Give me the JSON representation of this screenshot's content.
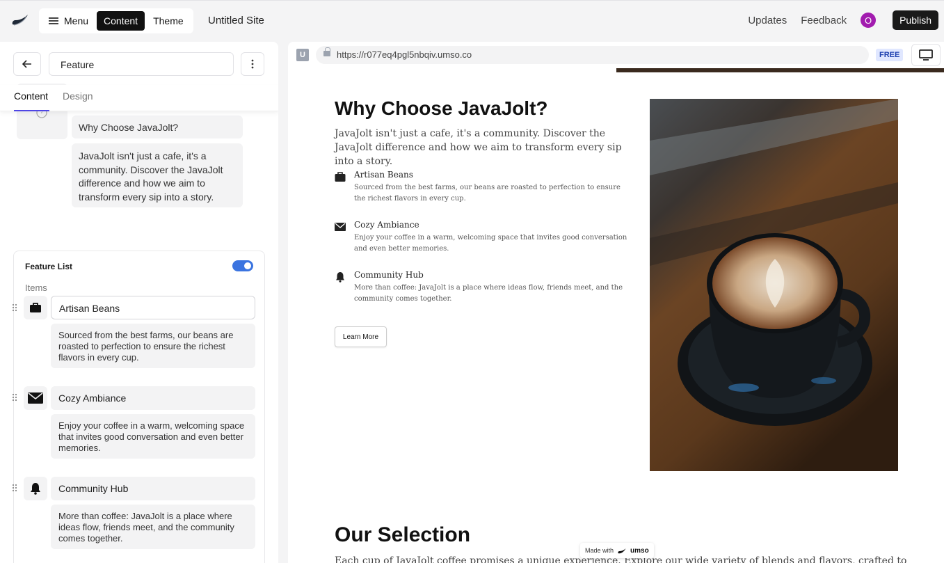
{
  "topbar": {
    "menu_label": "Menu",
    "content_label": "Content",
    "theme_label": "Theme",
    "site_title": "Untitled Site",
    "updates_label": "Updates",
    "feedback_label": "Feedback",
    "avatar_initial": "O",
    "publish_label": "Publish"
  },
  "panel": {
    "section_name": "Feature",
    "tabs": [
      {
        "label": "Content"
      },
      {
        "label": "Design"
      }
    ],
    "heading_value": "Why Choose JavaJolt?",
    "intro_value": "JavaJolt isn't just a cafe, it's a community. Discover the JavaJolt difference and how we aim to transform every sip into a story.",
    "feature_list_label": "Feature List",
    "feature_list_enabled": true,
    "items_label": "Items",
    "items": [
      {
        "icon": "briefcase-icon",
        "title": "Artisan Beans",
        "desc": "Sourced from the best farms, our beans are roasted to perfection to ensure the richest flavors in every cup."
      },
      {
        "icon": "envelope-icon",
        "title": "Cozy Ambiance",
        "desc": "Enjoy your coffee in a warm, welcoming space that invites good conversation and even better memories."
      },
      {
        "icon": "bell-icon",
        "title": "Community Hub",
        "desc": "More than coffee: JavaJolt is a place where ideas flow, friends meet, and the community comes together."
      }
    ]
  },
  "preview": {
    "url": "https://r077eq4pgl5nbqiv.umso.co",
    "plan_badge": "FREE",
    "heading": "Why Choose JavaJolt?",
    "intro": "JavaJolt isn't just a cafe, it's a community. Discover the JavaJolt difference and how we aim to transform every sip into a story.",
    "features": [
      {
        "title": "Artisan Beans",
        "desc": "Sourced from the best farms, our beans are roasted to perfection to ensure the richest flavors in every cup."
      },
      {
        "title": "Cozy Ambiance",
        "desc": "Enjoy your coffee in a warm, welcoming space that invites good conversation and even better memories."
      },
      {
        "title": "Community Hub",
        "desc": "More than coffee: JavaJolt is a place where ideas flow, friends meet, and the community comes together."
      }
    ],
    "cta_label": "Learn More",
    "next_heading": "Our Selection",
    "next_text": "Each cup of JavaJolt coffee promises a unique experience. Explore our wide variety of blends and flavors, crafted to",
    "made_with_label": "Made with",
    "brand": "umso"
  },
  "colors": {
    "accent": "#4f46e5",
    "toggle": "#3b74e0",
    "avatar": "#a21caf"
  }
}
